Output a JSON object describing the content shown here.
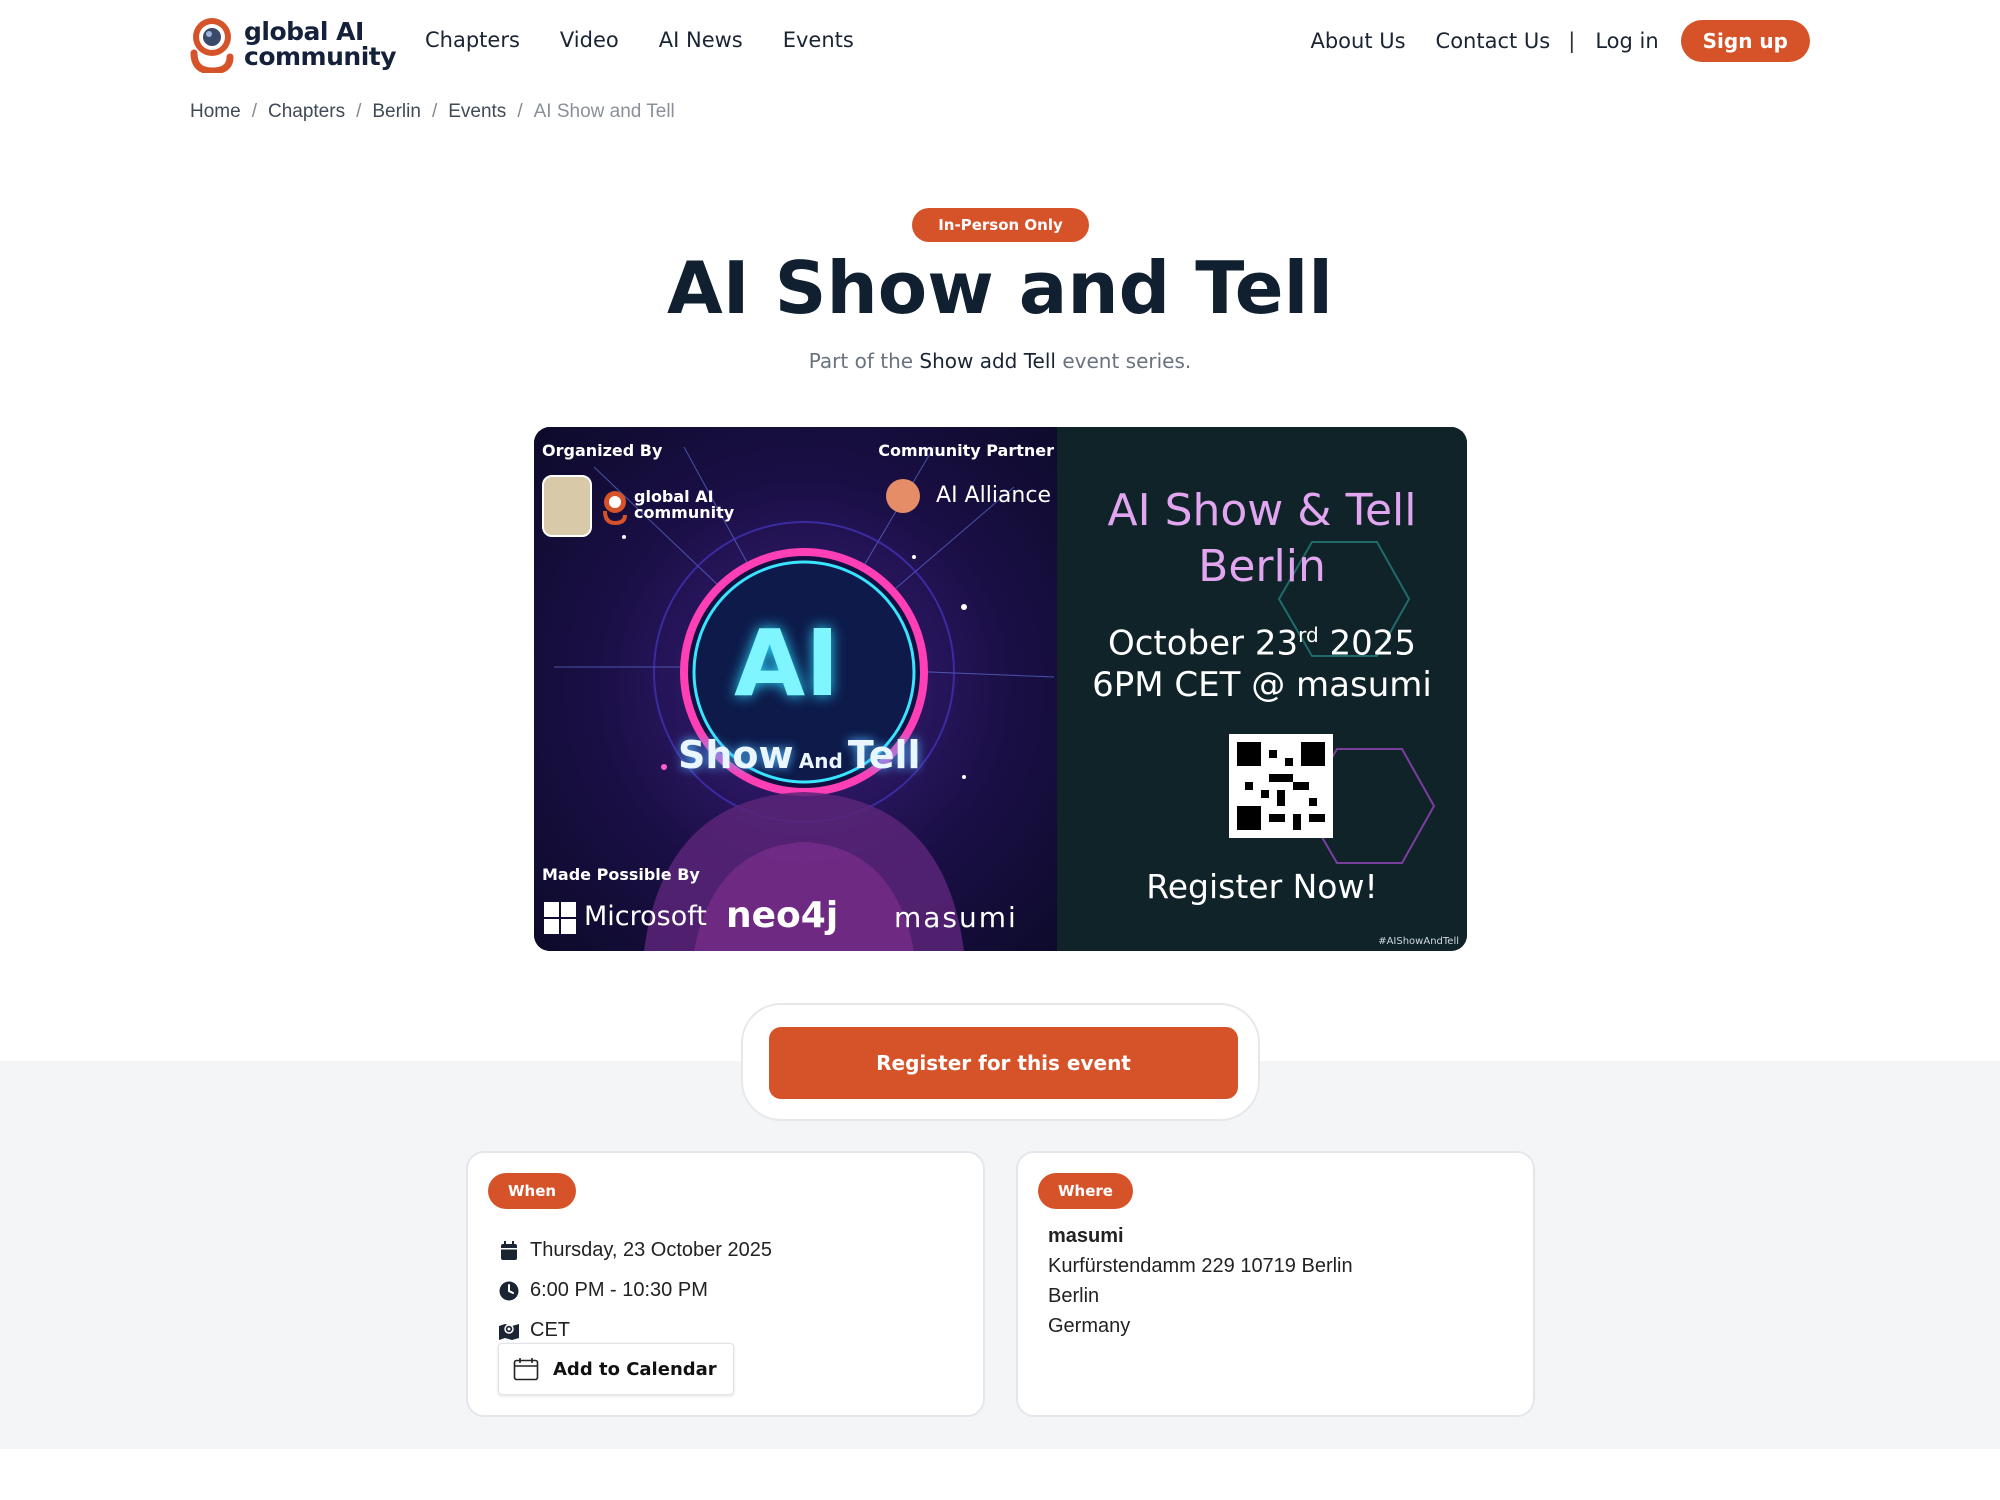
{
  "header": {
    "logo": {
      "line1": "global AI",
      "line2": "community"
    },
    "nav_left": [
      "Chapters",
      "Video",
      "AI News",
      "Events"
    ],
    "nav_right": {
      "about": "About Us",
      "contact": "Contact Us",
      "separator": "|",
      "login": "Log in",
      "signup": "Sign up"
    }
  },
  "breadcrumb": [
    "Home",
    "Chapters",
    "Berlin",
    "Events",
    "AI Show and Tell"
  ],
  "hero": {
    "badge": "In-Person Only",
    "title": "AI Show and Tell",
    "subtitle_prefix": "Part of the",
    "series_link": "Show add Tell",
    "subtitle_suffix": "event series."
  },
  "banner": {
    "organized_by": "Organized By",
    "community_partner": "Community Partner",
    "partner_name": "AI Alliance",
    "org_logo_line1": "global AI",
    "org_logo_line2": "community",
    "ai_text": "AI",
    "show_text": "Show",
    "and_text": "And",
    "tell_text": "Tell",
    "made_possible_by": "Made Possible By",
    "sponsors": [
      "Microsoft",
      "neo4j",
      "masumi"
    ],
    "right_title_line1": "AI Show & Tell",
    "right_title_line2": "Berlin",
    "date_prefix": "October 23",
    "date_sup": "rd",
    "date_suffix": " 2025",
    "time_location": "6PM CET @ masumi",
    "register_now": "Register Now!",
    "hashtag": "#AIShowAndTell"
  },
  "register_button": "Register for this event",
  "when": {
    "label": "When",
    "date": "Thursday, 23 October 2025",
    "time": "6:00 PM - 10:30 PM",
    "timezone": "CET",
    "add_to_calendar": "Add to Calendar"
  },
  "where": {
    "label": "Where",
    "venue": "masumi",
    "street": "Kurfürstendamm 229 10719 Berlin",
    "city": "Berlin",
    "country": "Germany"
  },
  "colors": {
    "accent": "#d6532a",
    "heading": "#102030",
    "section_bg": "#f4f5f7"
  }
}
